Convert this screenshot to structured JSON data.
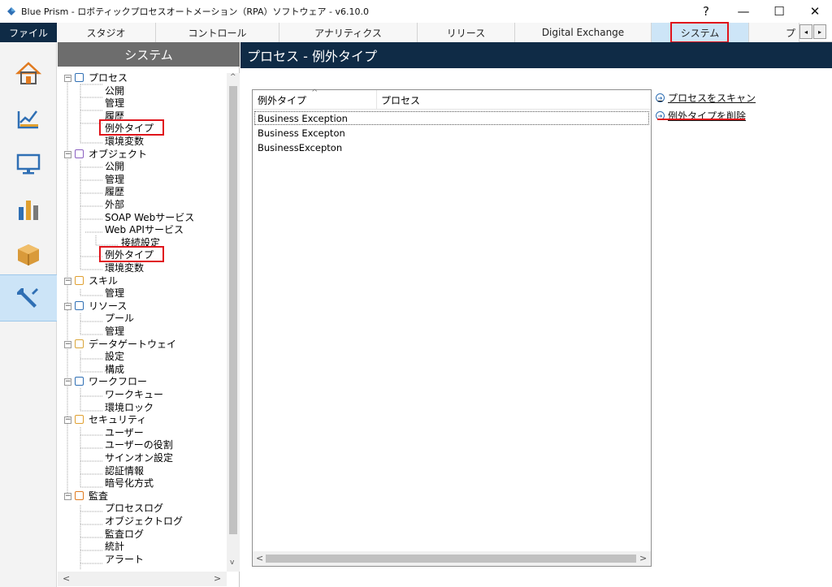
{
  "window": {
    "title": "Blue Prism - ロボティックプロセスオートメーション（RPA）ソフトウェア - v6.10.0",
    "help": "?",
    "minimize": "—",
    "maximize": "☐",
    "close": "✕"
  },
  "tabs": {
    "file": "ファイル",
    "items": [
      "スタジオ",
      "コントロール",
      "アナリティクス",
      "リリース",
      "Digital Exchange",
      "システム",
      "プ"
    ],
    "active": "システム",
    "scroll_left": "◂",
    "scroll_right": "▸"
  },
  "sidebar_icons": [
    "home-icon",
    "studio-icon",
    "control-icon",
    "analytics-icon",
    "release-icon",
    "system-icon"
  ],
  "tree": {
    "header": "システム",
    "scroll_left": "<",
    "scroll_right": ">",
    "scroll_up": "^",
    "scroll_down": "v",
    "nodes": [
      {
        "label": "プロセス",
        "level": 0,
        "icon": "process-icon"
      },
      {
        "label": "公開",
        "level": 1
      },
      {
        "label": "管理",
        "level": 1
      },
      {
        "label": "履歴",
        "level": 1
      },
      {
        "label": "例外タイプ",
        "level": 1,
        "selected": true
      },
      {
        "label": "環境変数",
        "level": 1
      },
      {
        "label": "オブジェクト",
        "level": 0,
        "icon": "object-icon"
      },
      {
        "label": "公開",
        "level": 1
      },
      {
        "label": "管理",
        "level": 1
      },
      {
        "label": "履歴",
        "level": 1
      },
      {
        "label": "外部",
        "level": 1
      },
      {
        "label": "SOAP Webサービス",
        "level": 1
      },
      {
        "label": "Web APIサービス",
        "level": 1
      },
      {
        "label": "接続設定",
        "level": 2
      },
      {
        "label": "例外タイプ",
        "level": 1,
        "highlighted": true
      },
      {
        "label": "環境変数",
        "level": 1
      },
      {
        "label": "スキル",
        "level": 0,
        "icon": "skill-icon"
      },
      {
        "label": "管理",
        "level": 1
      },
      {
        "label": "リソース",
        "level": 0,
        "icon": "resource-icon"
      },
      {
        "label": "プール",
        "level": 1
      },
      {
        "label": "管理",
        "level": 1
      },
      {
        "label": "データゲートウェイ",
        "level": 0,
        "icon": "data-gateway-icon"
      },
      {
        "label": "設定",
        "level": 1
      },
      {
        "label": "構成",
        "level": 1
      },
      {
        "label": "ワークフロー",
        "level": 0,
        "icon": "workflow-icon"
      },
      {
        "label": "ワークキュー",
        "level": 1
      },
      {
        "label": "環境ロック",
        "level": 1
      },
      {
        "label": "セキュリティ",
        "level": 0,
        "icon": "security-icon"
      },
      {
        "label": "ユーザー",
        "level": 1
      },
      {
        "label": "ユーザーの役割",
        "level": 1
      },
      {
        "label": "サインオン設定",
        "level": 1
      },
      {
        "label": "認証情報",
        "level": 1
      },
      {
        "label": "暗号化方式",
        "level": 1
      },
      {
        "label": "監査",
        "level": 0,
        "icon": "audit-icon"
      },
      {
        "label": "プロセスログ",
        "level": 1
      },
      {
        "label": "オブジェクトログ",
        "level": 1
      },
      {
        "label": "監査ログ",
        "level": 1
      },
      {
        "label": "統計",
        "level": 1
      },
      {
        "label": "アラート",
        "level": 1
      }
    ]
  },
  "content": {
    "header": "プロセス - 例外タイプ",
    "columns": [
      "例外タイプ",
      "プロセス"
    ],
    "sort_indicator": "^",
    "rows": [
      "Business Exception",
      "Business Excepton",
      "BusinessExcepton"
    ],
    "scroll_left": "<",
    "scroll_right": ">",
    "links": [
      "プロセスをスキャン",
      "例外タイプを削除"
    ]
  },
  "colors": {
    "navy": "#0f2b46",
    "highlight_red": "#e0141b",
    "active_tab": "#cde5f7",
    "link_blue": "#2f6fb4"
  }
}
